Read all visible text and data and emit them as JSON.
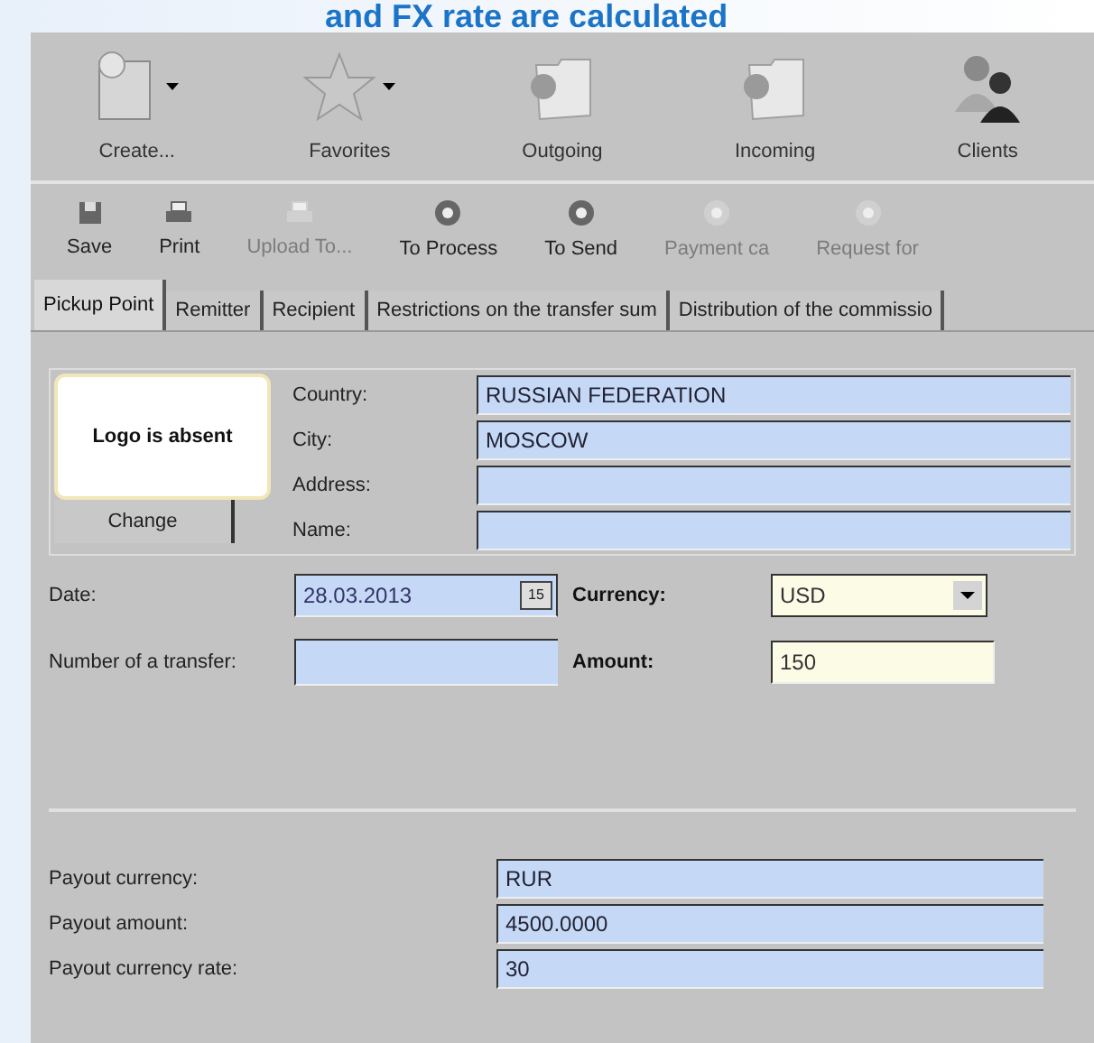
{
  "slide_title": "and FX rate are calculated",
  "main_toolbar": [
    {
      "label": "Create...",
      "kind": "document",
      "dropdown": true
    },
    {
      "label": "Favorites",
      "kind": "star",
      "dropdown": true
    },
    {
      "label": "Outgoing",
      "kind": "folder",
      "dropdown": false
    },
    {
      "label": "Incoming",
      "kind": "folder",
      "dropdown": false
    },
    {
      "label": "Clients",
      "kind": "people",
      "dropdown": false
    }
  ],
  "actions": [
    {
      "label": "Save",
      "kind": "disk",
      "disabled": false
    },
    {
      "label": "Print",
      "kind": "printer",
      "disabled": false
    },
    {
      "label": "Upload To...",
      "kind": "printer",
      "disabled": true
    },
    {
      "label": "To Process",
      "kind": "circle",
      "disabled": false
    },
    {
      "label": "To Send",
      "kind": "circle",
      "disabled": false
    },
    {
      "label": "Payment ca",
      "kind": "circle",
      "disabled": true
    },
    {
      "label": "Request for",
      "kind": "circle",
      "disabled": true
    }
  ],
  "tabs": [
    {
      "label": "Pickup Point",
      "selected": true
    },
    {
      "label": "Remitter",
      "selected": false
    },
    {
      "label": "Recipient",
      "selected": false
    },
    {
      "label": "Restrictions on the transfer sum",
      "selected": false
    },
    {
      "label": "Distribution of the commissio",
      "selected": false
    }
  ],
  "pickup_point": {
    "logo_text": "Logo is absent",
    "change_button": "Change",
    "fields": [
      {
        "label": "Country:",
        "value": "RUSSIAN FEDERATION"
      },
      {
        "label": "City:",
        "value": "MOSCOW"
      },
      {
        "label": "Address:"
      },
      {
        "label": "Name:"
      }
    ]
  },
  "transfer": {
    "date_label": "Date:",
    "date_value": "28.03.2013",
    "calendar_button": "15",
    "number_label": "Number of a transfer:",
    "currency_label": "Currency:",
    "currency_value": "USD",
    "amount_label": "Amount:",
    "amount_value": "150"
  },
  "payout": [
    {
      "label": "Payout currency:",
      "value": "RUR"
    },
    {
      "label": "Payout amount:",
      "value": "4500.0000"
    },
    {
      "label": "Payout currency rate:",
      "value": "30"
    }
  ]
}
